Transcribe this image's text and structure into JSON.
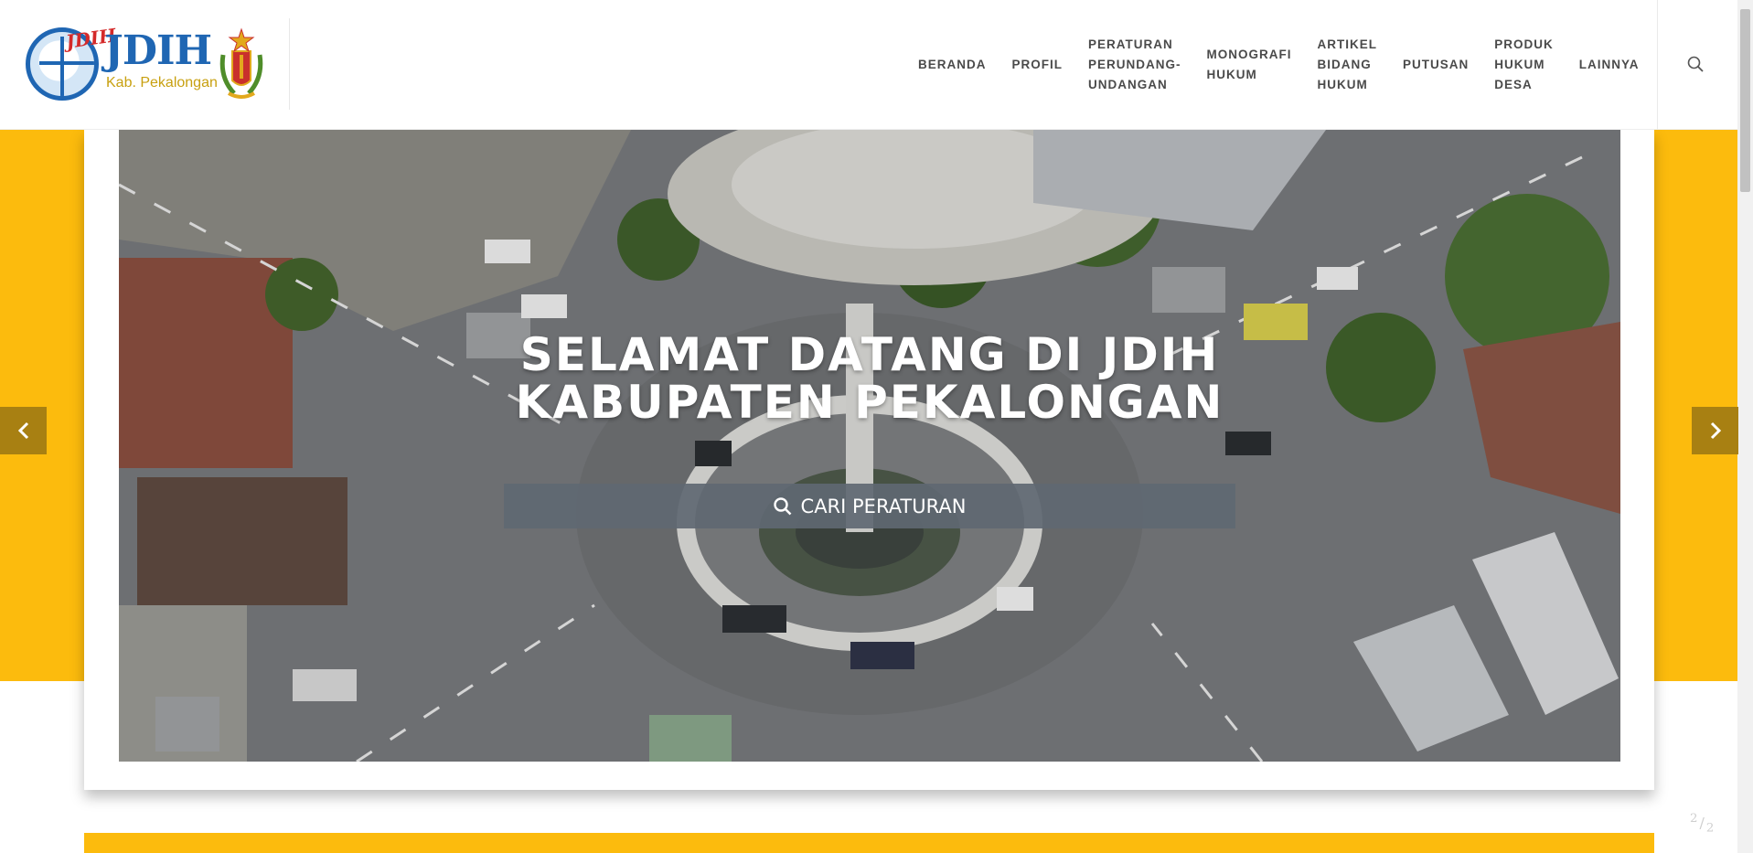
{
  "header": {
    "logo": {
      "mark": "JDIH",
      "mark_small": "JDIH",
      "subtitle": "Kab. Pekalongan"
    },
    "nav": [
      {
        "lines": [
          "BERANDA"
        ]
      },
      {
        "lines": [
          "PROFIL"
        ]
      },
      {
        "lines": [
          "PERATURAN",
          "PERUNDANG-",
          "UNDANGAN"
        ]
      },
      {
        "lines": [
          "MONOGRAFI",
          "HUKUM"
        ]
      },
      {
        "lines": [
          "ARTIKEL",
          "BIDANG",
          "HUKUM"
        ]
      },
      {
        "lines": [
          "PUTUSAN"
        ]
      },
      {
        "lines": [
          "PRODUK",
          "HUKUM",
          "DESA"
        ]
      },
      {
        "lines": [
          "LAINNYA"
        ]
      }
    ],
    "search_icon": "search-icon"
  },
  "hero": {
    "title_line1": "SELAMAT DATANG DI JDIH",
    "title_line2": "KABUPATEN PEKALONGAN",
    "search_button": "CARI PERATURAN"
  },
  "slider": {
    "prev_icon": "chevron-left-icon",
    "next_icon": "chevron-right-icon",
    "pager_current": "2",
    "pager_total": "2"
  },
  "colors": {
    "accent": "#fcbb0d",
    "arrow": "#a88012",
    "logo_blue": "#1f66b3"
  }
}
